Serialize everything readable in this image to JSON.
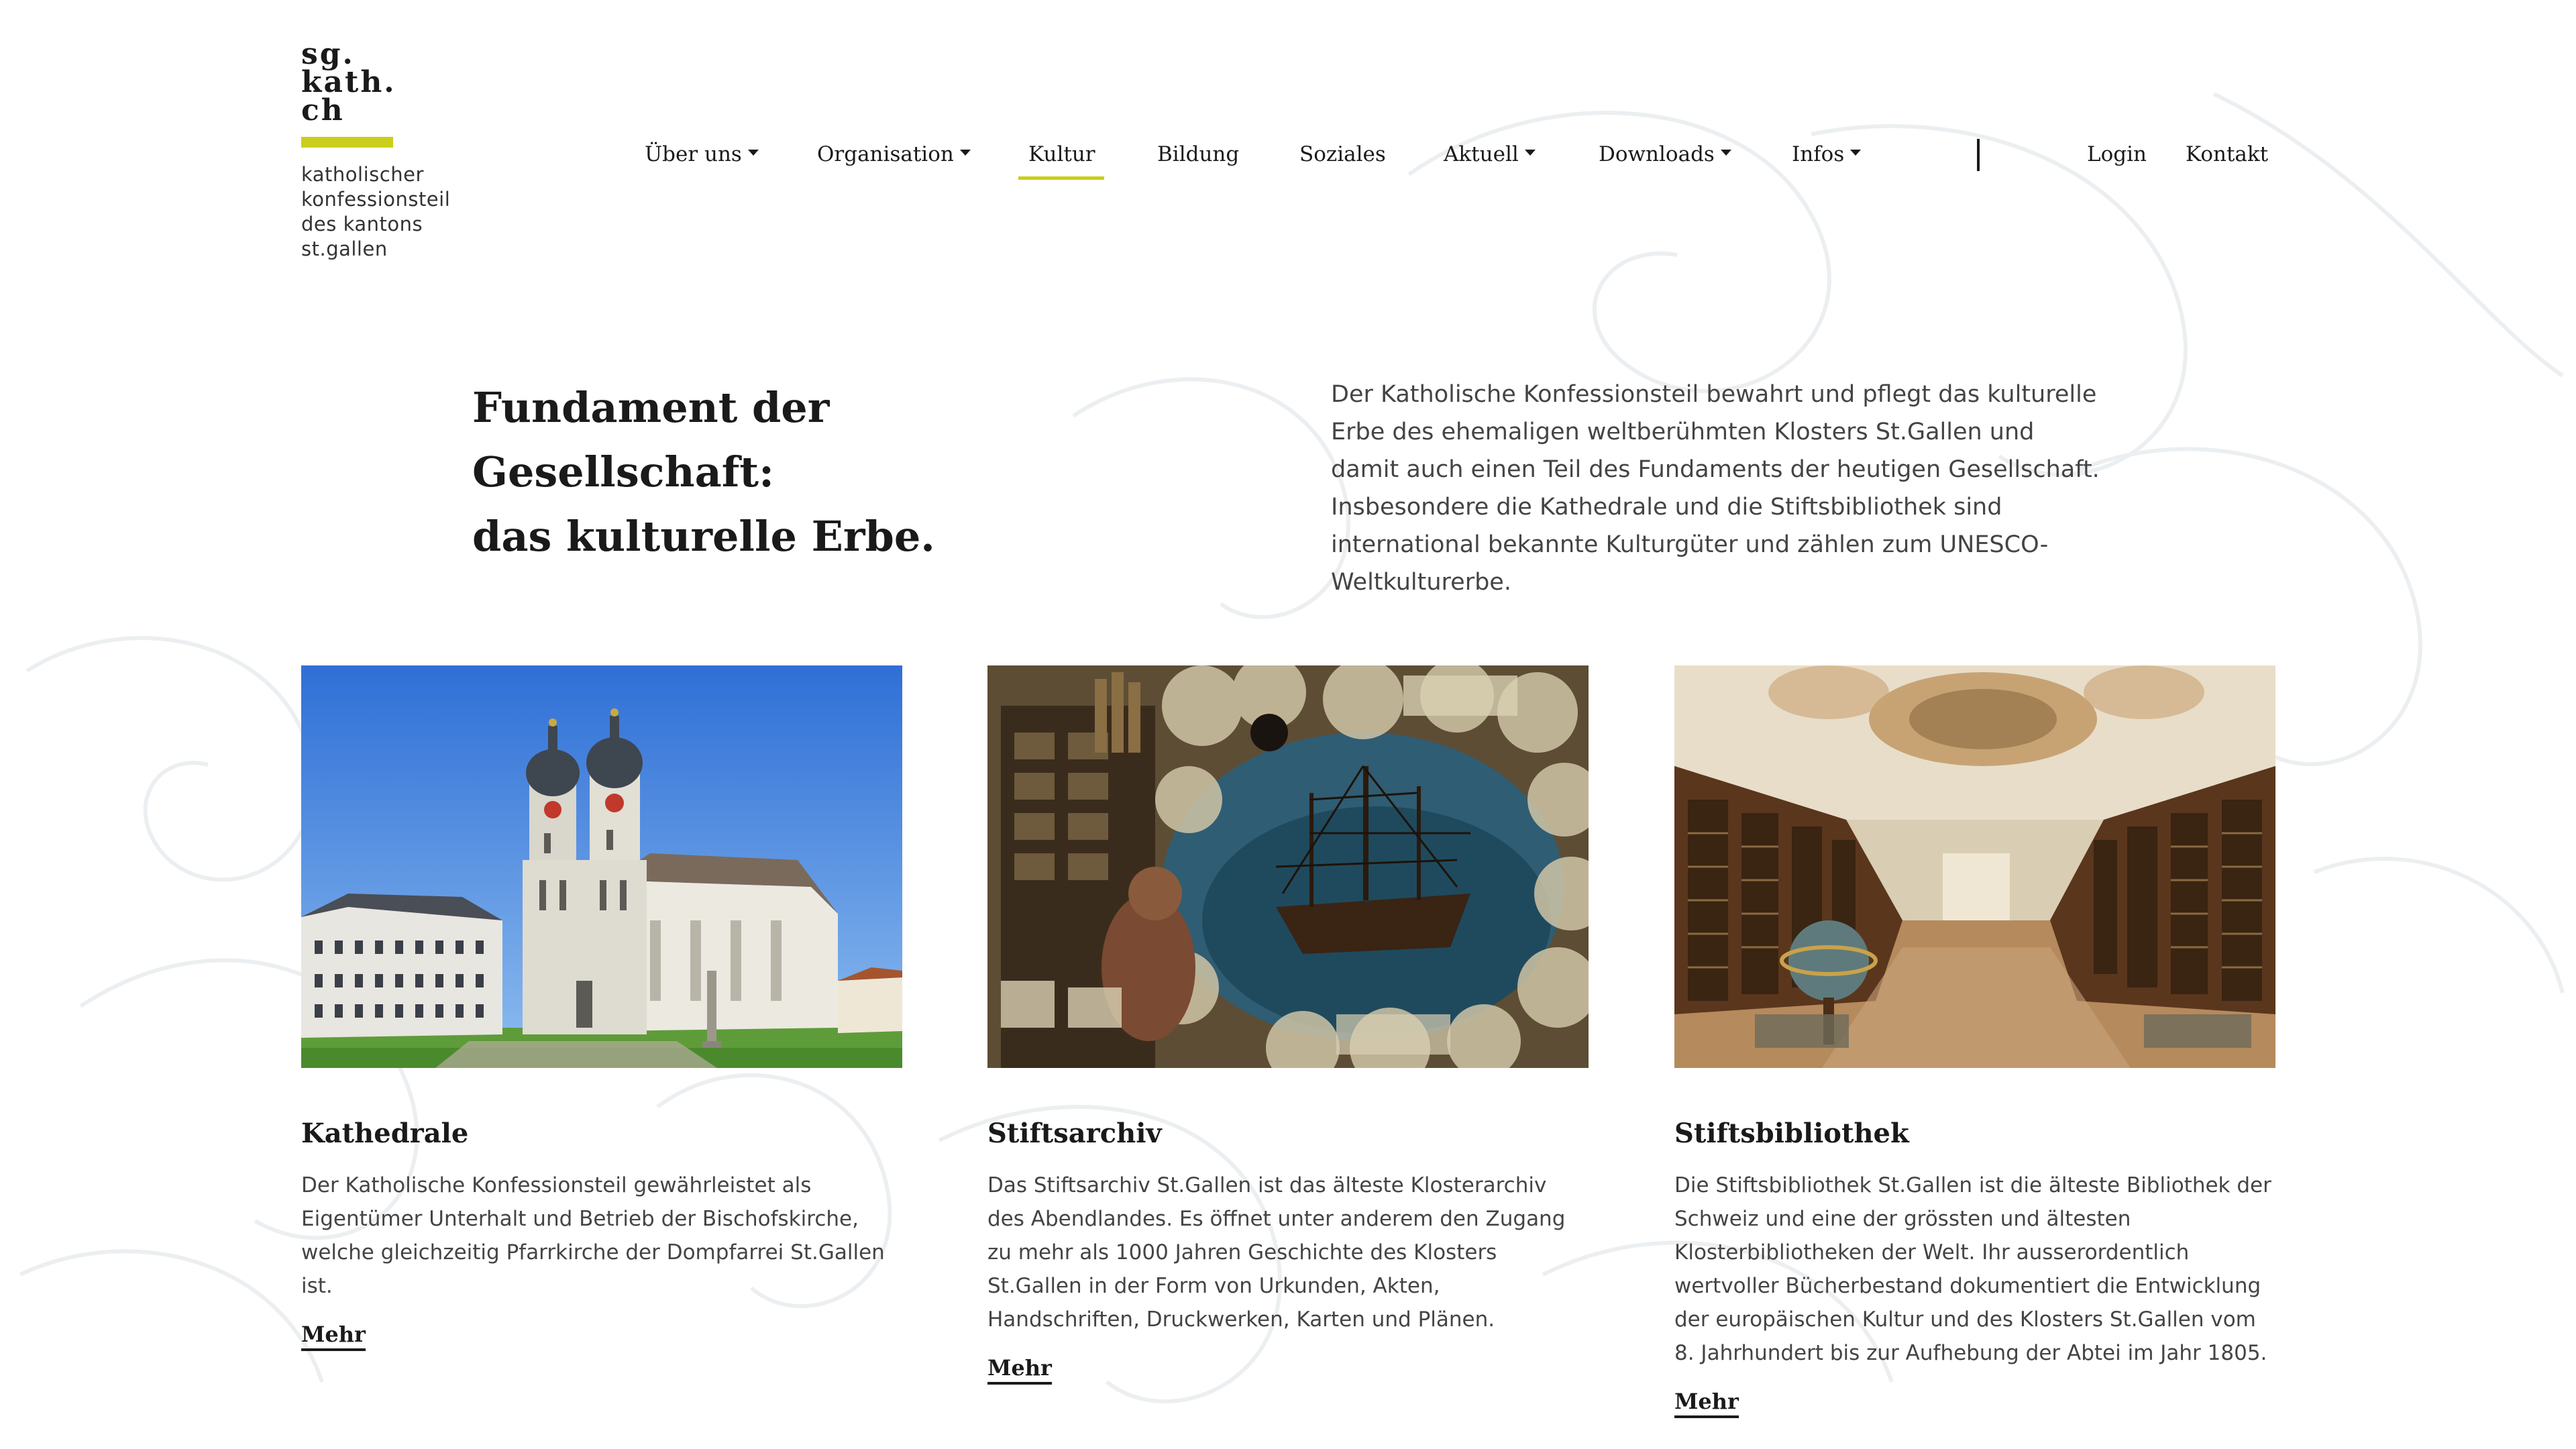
{
  "logo": {
    "mark_lines": [
      "sg.",
      "kath.",
      "ch"
    ],
    "sub_lines": [
      "katholischer",
      "konfessionsteil",
      "des kantons",
      "st.gallen"
    ]
  },
  "nav": {
    "items": [
      {
        "label": "Über uns",
        "dropdown": true
      },
      {
        "label": "Organisation",
        "dropdown": true
      },
      {
        "label": "Kultur",
        "dropdown": false,
        "active": true
      },
      {
        "label": "Bildung",
        "dropdown": false
      },
      {
        "label": "Soziales",
        "dropdown": false
      },
      {
        "label": "Aktuell",
        "dropdown": true
      },
      {
        "label": "Downloads",
        "dropdown": true
      },
      {
        "label": "Infos",
        "dropdown": true
      }
    ],
    "login": "Login",
    "kontakt": "Kontakt"
  },
  "hero": {
    "title_line1": "Fundament der Gesellschaft:",
    "title_line2": "das kulturelle Erbe.",
    "text": "Der Katholische Konfessionsteil bewahrt und pflegt das kulturelle Erbe des ehemaligen weltberühmten Klosters St.Gallen und damit auch einen Teil des Fundaments der heutigen Gesellschaft. Insbesondere die Kathedrale und die Stiftsbibliothek sind international bekannte Kulturgüter und zählen zum UNESCO-Weltkulturerbe."
  },
  "cards": [
    {
      "title": "Kathedrale",
      "text": "Der Katholische Konfessionsteil gewährleistet als Eigentümer Unterhalt und Betrieb der Bischofskirche, welche gleichzeitig Pfarrkirche der Dompfarrei St.Gallen ist.",
      "more": "Mehr"
    },
    {
      "title": "Stiftsarchiv",
      "text": "Das Stiftsarchiv St.Gallen ist das älteste Klosterarchiv des Abendlandes. Es öffnet unter anderem den Zugang zu mehr als 1000 Jahren Geschichte des Klosters St.Gallen in der Form von Urkunden, Akten, Handschriften, Druckwerken, Karten und Plänen.",
      "more": "Mehr"
    },
    {
      "title": "Stiftsbibliothek",
      "text": "Die Stiftsbibliothek St.Gallen ist die älteste Bibliothek der Schweiz und eine der grössten und ältesten Klosterbibliotheken der Welt. Ihr ausserordentlich wertvoller Bücherbestand dokumentiert die Entwicklung der europäischen Kultur und des Klosters St.Gallen vom 8. Jahrhundert bis zur Aufhebung der Abtei im Jahr 1805.",
      "more": "Mehr"
    }
  ],
  "colors": {
    "accent": "#c9cf1a",
    "text": "#1a1a1a",
    "body_text": "#444444"
  }
}
